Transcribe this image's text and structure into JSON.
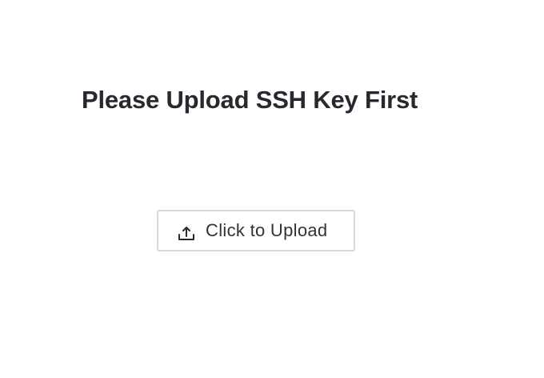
{
  "page": {
    "title": "Please Upload SSH Key First"
  },
  "upload": {
    "button_label": "Click to Upload",
    "icon": "upload-icon"
  }
}
